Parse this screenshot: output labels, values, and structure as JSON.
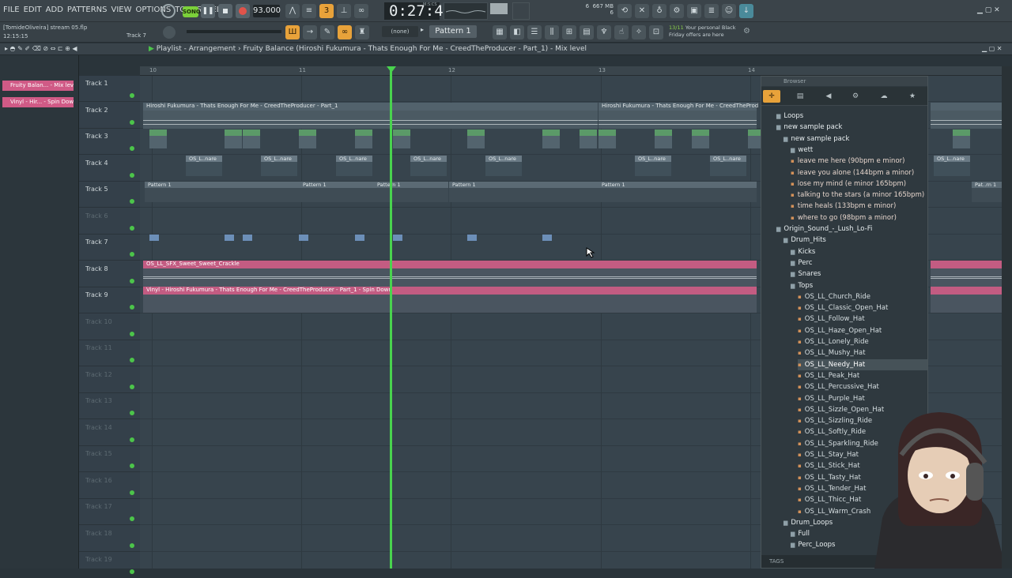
{
  "menu": [
    "FILE",
    "EDIT",
    "ADD",
    "PATTERNS",
    "VIEW",
    "OPTIONS",
    "TOOLS",
    "HELP"
  ],
  "transport": {
    "song_label": "SONG",
    "tempo": "93.000",
    "time": "0:27:40",
    "time_unit": "M:S:CS"
  },
  "monitor": {
    "cpu": "6",
    "ram": "667 MB",
    "poly": "6"
  },
  "project": {
    "file": "[TomideOliveira] stream 05.flp",
    "clock": "12:15:15",
    "hint": "Track 7"
  },
  "pattern": {
    "none_label": "(none)",
    "selected": "Pattern 1"
  },
  "promo": {
    "date": "13/11",
    "text": "Your personal Black Friday offers are here"
  },
  "playlist": {
    "title": "Playlist - Arrangement",
    "breadcrumb": "Fruity Balance (Hiroshi Fukumura - Thats Enough For Me - CreedTheProducer - Part_1) - Mix level",
    "clip_list": [
      "Fruity Balan... - Mix level",
      "Vinyl - Hir... - Spin Down"
    ],
    "bars": [
      "10",
      "11",
      "12",
      "13",
      "14"
    ],
    "tracks": [
      "Track 1",
      "Track 2",
      "Track 3",
      "Track 4",
      "Track 5",
      "Track 6",
      "Track 7",
      "Track 8",
      "Track 9",
      "Track 10",
      "Track 11",
      "Track 12",
      "Track 13",
      "Track 14",
      "Track 15",
      "Track 16",
      "Track 17",
      "Track 18",
      "Track 19"
    ],
    "clip_labels": {
      "track2": "Hiroshi Fukumura - Thats Enough For Me - CreedTheProducer - Part_1",
      "track2b": "Hiroshi Fukumura - Thats Enough For Me - CreedTheProd",
      "track4": "OS_L..nare",
      "track5": "Pattern 1",
      "track5_end": "Pat..rn 1",
      "track8": "OS_LL_SFX_Sweet_Sweet_Crackle",
      "track9": "Vinyl - Hiroshi Fukumura - Thats Enough For Me - CreedTheProducer - Part_1 - Spin Down"
    }
  },
  "browser": {
    "title": "Browser",
    "tags_label": "TAGS",
    "items": [
      {
        "label": "Loops",
        "indent": 1,
        "type": "folder"
      },
      {
        "label": "new sample pack",
        "indent": 1,
        "type": "folder"
      },
      {
        "label": "new sample pack",
        "indent": 2,
        "type": "folder"
      },
      {
        "label": "wett",
        "indent": 3,
        "type": "folder"
      },
      {
        "label": "leave me here (90bpm e minor)",
        "indent": 3,
        "type": "audio"
      },
      {
        "label": "leave you alone (144bpm a minor)",
        "indent": 3,
        "type": "audio"
      },
      {
        "label": "lose my mind (e minor 165bpm)",
        "indent": 3,
        "type": "audio"
      },
      {
        "label": "talking to the stars (a minor 165bpm)",
        "indent": 3,
        "type": "audio"
      },
      {
        "label": "time heals (133bpm e minor)",
        "indent": 3,
        "type": "audio"
      },
      {
        "label": "where to go (98bpm a minor)",
        "indent": 3,
        "type": "audio"
      },
      {
        "label": "Origin_Sound_-_Lush_Lo-Fi",
        "indent": 1,
        "type": "folder"
      },
      {
        "label": "Drum_Hits",
        "indent": 2,
        "type": "folder"
      },
      {
        "label": "Kicks",
        "indent": 3,
        "type": "folder"
      },
      {
        "label": "Perc",
        "indent": 3,
        "type": "folder"
      },
      {
        "label": "Snares",
        "indent": 3,
        "type": "folder"
      },
      {
        "label": "Tops",
        "indent": 3,
        "type": "folder"
      },
      {
        "label": "OS_LL_Church_Ride",
        "indent": 4,
        "type": "file"
      },
      {
        "label": "OS_LL_Classic_Open_Hat",
        "indent": 4,
        "type": "file"
      },
      {
        "label": "OS_LL_Follow_Hat",
        "indent": 4,
        "type": "file"
      },
      {
        "label": "OS_LL_Haze_Open_Hat",
        "indent": 4,
        "type": "file"
      },
      {
        "label": "OS_LL_Lonely_Ride",
        "indent": 4,
        "type": "file"
      },
      {
        "label": "OS_LL_Mushy_Hat",
        "indent": 4,
        "type": "file"
      },
      {
        "label": "OS_LL_Needy_Hat",
        "indent": 4,
        "type": "file",
        "selected": true
      },
      {
        "label": "OS_LL_Peak_Hat",
        "indent": 4,
        "type": "file"
      },
      {
        "label": "OS_LL_Percussive_Hat",
        "indent": 4,
        "type": "file"
      },
      {
        "label": "OS_LL_Purple_Hat",
        "indent": 4,
        "type": "file"
      },
      {
        "label": "OS_LL_Sizzle_Open_Hat",
        "indent": 4,
        "type": "file"
      },
      {
        "label": "OS_LL_Sizzling_Ride",
        "indent": 4,
        "type": "file"
      },
      {
        "label": "OS_LL_Softly_Ride",
        "indent": 4,
        "type": "file"
      },
      {
        "label": "OS_LL_Sparkling_Ride",
        "indent": 4,
        "type": "file"
      },
      {
        "label": "OS_LL_Stay_Hat",
        "indent": 4,
        "type": "file"
      },
      {
        "label": "OS_LL_Stick_Hat",
        "indent": 4,
        "type": "file"
      },
      {
        "label": "OS_LL_Tasty_Hat",
        "indent": 4,
        "type": "file"
      },
      {
        "label": "OS_LL_Tender_Hat",
        "indent": 4,
        "type": "file"
      },
      {
        "label": "OS_LL_Thicc_Hat",
        "indent": 4,
        "type": "file"
      },
      {
        "label": "OS_LL_Warm_Crash",
        "indent": 4,
        "type": "file"
      },
      {
        "label": "Drum_Loops",
        "indent": 2,
        "type": "folder"
      },
      {
        "label": "Full",
        "indent": 3,
        "type": "folder"
      },
      {
        "label": "Perc_Loops",
        "indent": 3,
        "type": "folder"
      }
    ]
  },
  "colors": {
    "accent": "#49d34e",
    "clip_pink": "#c35c82",
    "song_green": "#7bd03a",
    "record_red": "#e0534a"
  }
}
